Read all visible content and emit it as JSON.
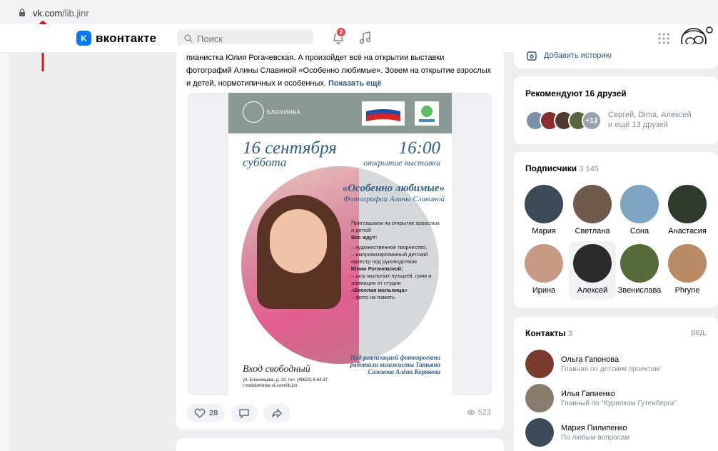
{
  "browser": {
    "url_host": "vk.com",
    "url_path": "/lib.jinr"
  },
  "header": {
    "logo_badge": "K",
    "logo_text": "вконтакте",
    "search_placeholder": "Поиск",
    "notifications_count": "2"
  },
  "post": {
    "text_line1": "пианистка Юлия Рогачевская. А произойдет всё на открытии выставки",
    "text_line2": "фотографий Алины Славиной «Особенно любимые». Зовем на открытие взрослых",
    "text_line3": "и детей, нормотипичных и особенных.",
    "show_more": "Показать ещё",
    "poster": {
      "org_name": "БЛОХИНКА",
      "date": "16 сентября",
      "weekday": "суббота",
      "time": "16:00",
      "opening": "открытие выставки",
      "title": "«Особенно любимые»",
      "subtitle": "Фотографии Алины Славиной",
      "invite": "Приглашаем на открытие взрослых и детей!",
      "awaits": "Вас ждут:",
      "item1": "– художественное творчество;",
      "item2": "– импровизированный детский оркестр под руководством",
      "item2_name": "Юлии Рогачевской;",
      "item3": "– шоу мыльных пузырей, грим и анимация от студии",
      "item3_name": "«Веселая мельница»",
      "item4": "– фото на память",
      "free_entry": "Вход свободный",
      "address": "ул. Блохинцева, д. 13, тел. (49621) 6-64-37",
      "links": "t.me/blokhinka   vk.com/lib.jinr",
      "credits": "Над реализацией фотопроекта работали визажисты Татьяна Сазонова Алёна Корякова"
    },
    "likes": "28",
    "views": "523"
  },
  "sidebar": {
    "add_story": "Добавить историю",
    "recommend_title": "Рекомендуют 16 друзей",
    "recommend_more": "+13",
    "recommend_text_1": "Сергей, Dima, Алексей",
    "recommend_text_2": "и ещё 13 друзей",
    "subscribers_title": "Подписчики",
    "subscribers_count": "3 145",
    "subscribers": [
      "Мария",
      "Светлана",
      "Сона",
      "Анастасия",
      "Ирина",
      "Алексей",
      "Звенислава",
      "Phryne"
    ],
    "contacts_title": "Контакты",
    "contacts_count": "3",
    "edit_label": "ред.",
    "contacts": [
      {
        "name": "Ольга Гапонова",
        "role": "Главная по детским проектам"
      },
      {
        "name": "Илья Гапиенко",
        "role": "Главный по \"Курилкам Гутенберга\""
      },
      {
        "name": "Мария Пилипенко",
        "role": "По любым вопросам"
      }
    ]
  },
  "colors": {
    "accent": "#0077ff",
    "link": "#2a5885",
    "background": "#edeef0",
    "annotation_red": "#e01010"
  }
}
